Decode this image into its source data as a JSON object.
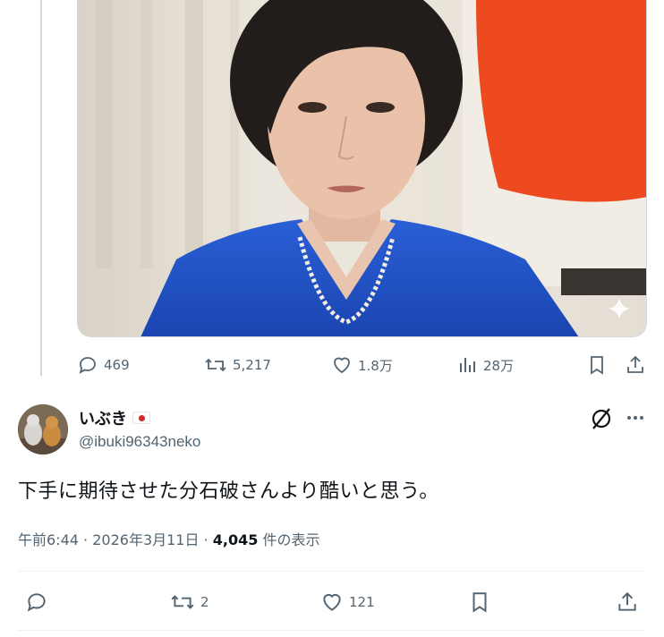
{
  "colors": {
    "text_primary": "#0f1419",
    "text_secondary": "#536471",
    "border": "#cfd9de",
    "flag_red": "#d62828",
    "suit_blue": "#1d4fc4"
  },
  "quoted_post": {
    "media_alt_icon": "sparkle-icon",
    "actions": {
      "replies": "469",
      "reposts": "5,217",
      "likes": "1.8万",
      "views": "28万"
    }
  },
  "reply_post": {
    "display_name": "いぶき",
    "name_badge": "japan-flag-icon",
    "handle": "@ibuki96343neko",
    "text": "下手に期待させた分石破さんより酷いと思う。",
    "meta": {
      "time": "午前6:44",
      "date": "2026年3月11日",
      "separator": "·",
      "views_count": "4,045",
      "views_label": "件の表示"
    },
    "actions": {
      "reposts": "2",
      "likes": "121"
    }
  }
}
